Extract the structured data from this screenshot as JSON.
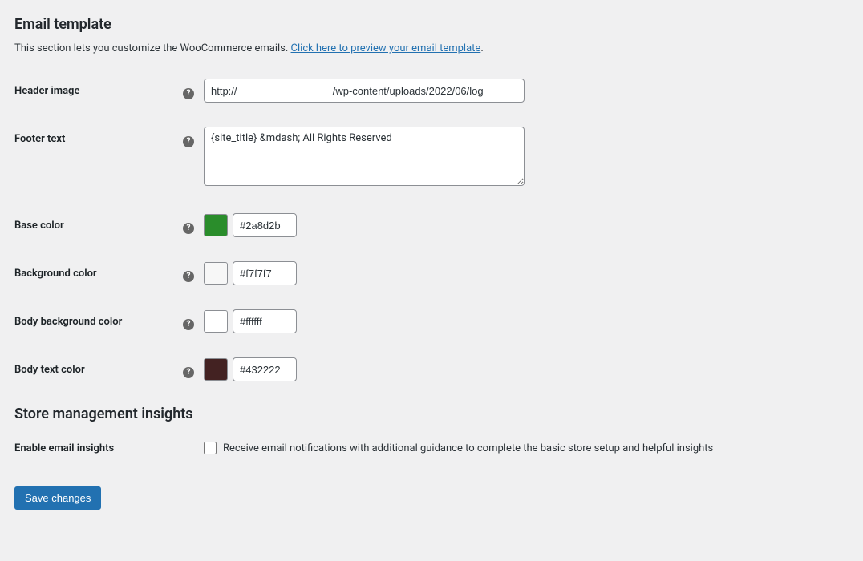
{
  "section1": {
    "title": "Email template",
    "desc_prefix": "This section lets you customize the WooCommerce emails. ",
    "desc_link": "Click here to preview your email template",
    "desc_suffix": "."
  },
  "fields": {
    "header_image": {
      "label": "Header image",
      "value": "http://                                 /wp-content/uploads/2022/06/log"
    },
    "footer_text": {
      "label": "Footer text",
      "value": "{site_title} &mdash; All Rights Reserved"
    },
    "base_color": {
      "label": "Base color",
      "value": "#2a8d2b",
      "swatch": "#2a8d2b"
    },
    "background_color": {
      "label": "Background color",
      "value": "#f7f7f7",
      "swatch": "#f7f7f7"
    },
    "body_bg_color": {
      "label": "Body background color",
      "value": "#ffffff",
      "swatch": "#ffffff"
    },
    "body_text_color": {
      "label": "Body text color",
      "value": "#432222",
      "swatch": "#432222"
    }
  },
  "section2": {
    "title": "Store management insights",
    "insights_label": "Enable email insights",
    "insights_desc": "Receive email notifications with additional guidance to complete the basic store setup and helpful insights"
  },
  "save_label": "Save changes"
}
